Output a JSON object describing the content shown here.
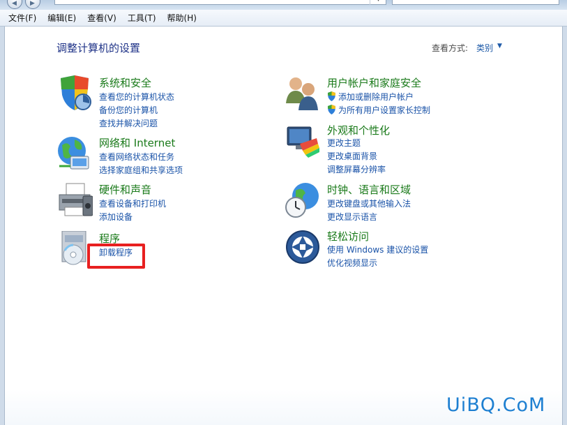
{
  "menu": [
    "文件(F)",
    "编辑(E)",
    "查看(V)",
    "工具(T)",
    "帮助(H)"
  ],
  "page_title": "调整计算机的设置",
  "view": {
    "label": "查看方式:",
    "value": "类别"
  },
  "categories": [
    {
      "title": "系统和安全",
      "icon": "shield-computer-icon",
      "links": [
        "查看您的计算机状态",
        "备份您的计算机",
        "查找并解决问题"
      ]
    },
    {
      "title": "网络和 Internet",
      "icon": "globe-network-icon",
      "links": [
        "查看网络状态和任务",
        "选择家庭组和共享选项"
      ]
    },
    {
      "title": "硬件和声音",
      "icon": "printer-icon",
      "links": [
        "查看设备和打印机",
        "添加设备"
      ]
    },
    {
      "title": "程序",
      "icon": "programs-disc-icon",
      "links": [
        "卸载程序"
      ]
    },
    {
      "title": "用户帐户和家庭安全",
      "icon": "users-icon",
      "links": [
        "添加或删除用户帐户",
        "为所有用户设置家长控制"
      ]
    },
    {
      "title": "外观和个性化",
      "icon": "monitor-palette-icon",
      "links": [
        "更改主题",
        "更改桌面背景",
        "调整屏幕分辨率"
      ]
    },
    {
      "title": "时钟、语言和区域",
      "icon": "globe-clock-icon",
      "links": [
        "更改键盘或其他输入法",
        "更改显示语言"
      ]
    },
    {
      "title": "轻松访问",
      "icon": "ease-of-access-icon",
      "links": [
        "使用 Windows 建议的设置",
        "优化视频显示"
      ]
    }
  ],
  "watermark": "UiBQ.CoM"
}
